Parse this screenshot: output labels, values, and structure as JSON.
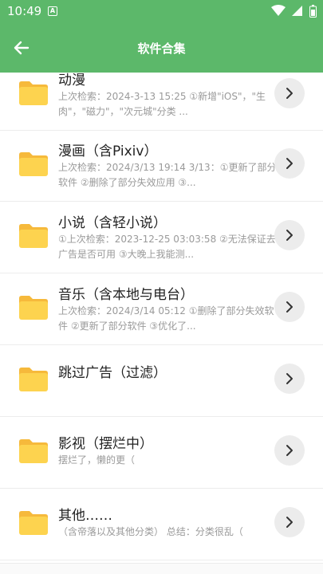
{
  "status_bar": {
    "time": "10:49",
    "notification_badge": "A"
  },
  "header": {
    "title": "软件合集",
    "back_icon": "arrow-left-icon"
  },
  "colors": {
    "primary": "#5cb86a",
    "folder": "#fdd34f",
    "folder_dark": "#f6b93b",
    "desc_text": "#9a9a9a"
  },
  "items": [
    {
      "title": "动漫",
      "desc": "上次检索：2024-3-13 15:25 ①新增\"iOS\"，\"生肉\"，\"磁力\"，\"次元城\"分类 ..."
    },
    {
      "title": "漫画（含Pixiv）",
      "desc": "上次检索：2024/3/13 19:14 3/13：①更新了部分软件 ②删除了部分失效应用 ③..."
    },
    {
      "title": "小说（含轻小说）",
      "desc": "①上次检索：2023-12-25 03:03:58 ②无法保证去广告是否可用 ③大晚上我能测..."
    },
    {
      "title": "音乐（含本地与电台）",
      "desc": "上次检索：2024/3/14 05:12 ①删除了部分失效软件 ②更新了部分软件 ③优化了..."
    },
    {
      "title": "跳过广告（过滤）",
      "desc": ""
    },
    {
      "title": "影视（摆烂中）",
      "desc": "摆烂了，懒的更（"
    },
    {
      "title": "其他……",
      "desc": "（含帝落以及其他分类） 总结：分类很乱（"
    }
  ]
}
